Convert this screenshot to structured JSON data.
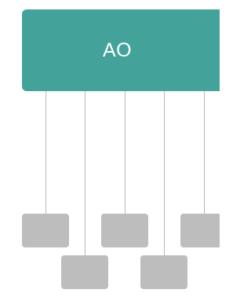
{
  "root": {
    "label": "AO",
    "color": "#43a39a"
  },
  "children": [
    {
      "label": ""
    },
    {
      "label": ""
    },
    {
      "label": ""
    },
    {
      "label": ""
    },
    {
      "label": ""
    },
    {
      "label": ""
    }
  ],
  "colors": {
    "child_fill": "#bdbdbd",
    "connector": "#b9b9b9"
  }
}
